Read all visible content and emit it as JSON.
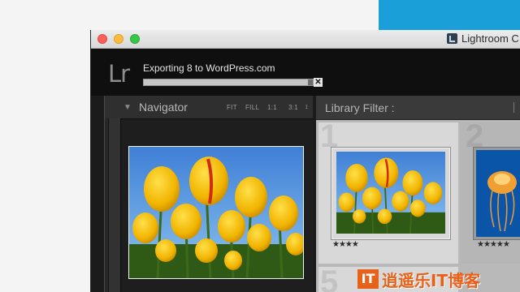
{
  "window": {
    "app_title": "Lightroom C",
    "app_icon": "lightroom-app-icon"
  },
  "identity": {
    "logo": "Lr",
    "export_label": "Exporting 8 to WordPress.com",
    "export_progress_fraction": 0.97,
    "close_glyph": "✕"
  },
  "navigator": {
    "collapse_glyph": "▼",
    "title": "Navigator",
    "zoom_options": [
      "FIT",
      "FILL",
      "1:1",
      "3:1"
    ],
    "zoom_arrow": "↕"
  },
  "library_filter": {
    "title": "Library Filter :"
  },
  "grid": {
    "cells": [
      {
        "number": "1",
        "stars": "★★★★",
        "image": "yellow-tulips"
      },
      {
        "number": "2",
        "stars": "★★★★★",
        "image": "jellyfish"
      },
      {
        "number": "5"
      }
    ]
  },
  "watermark": {
    "logo": "IT",
    "text": "逍遥乐IT博客"
  },
  "colors": {
    "desktop_accent": "#1a9fd8",
    "sky": "#4a8ad8",
    "tulip": "#f2b800",
    "watermark": "#e8611a"
  }
}
